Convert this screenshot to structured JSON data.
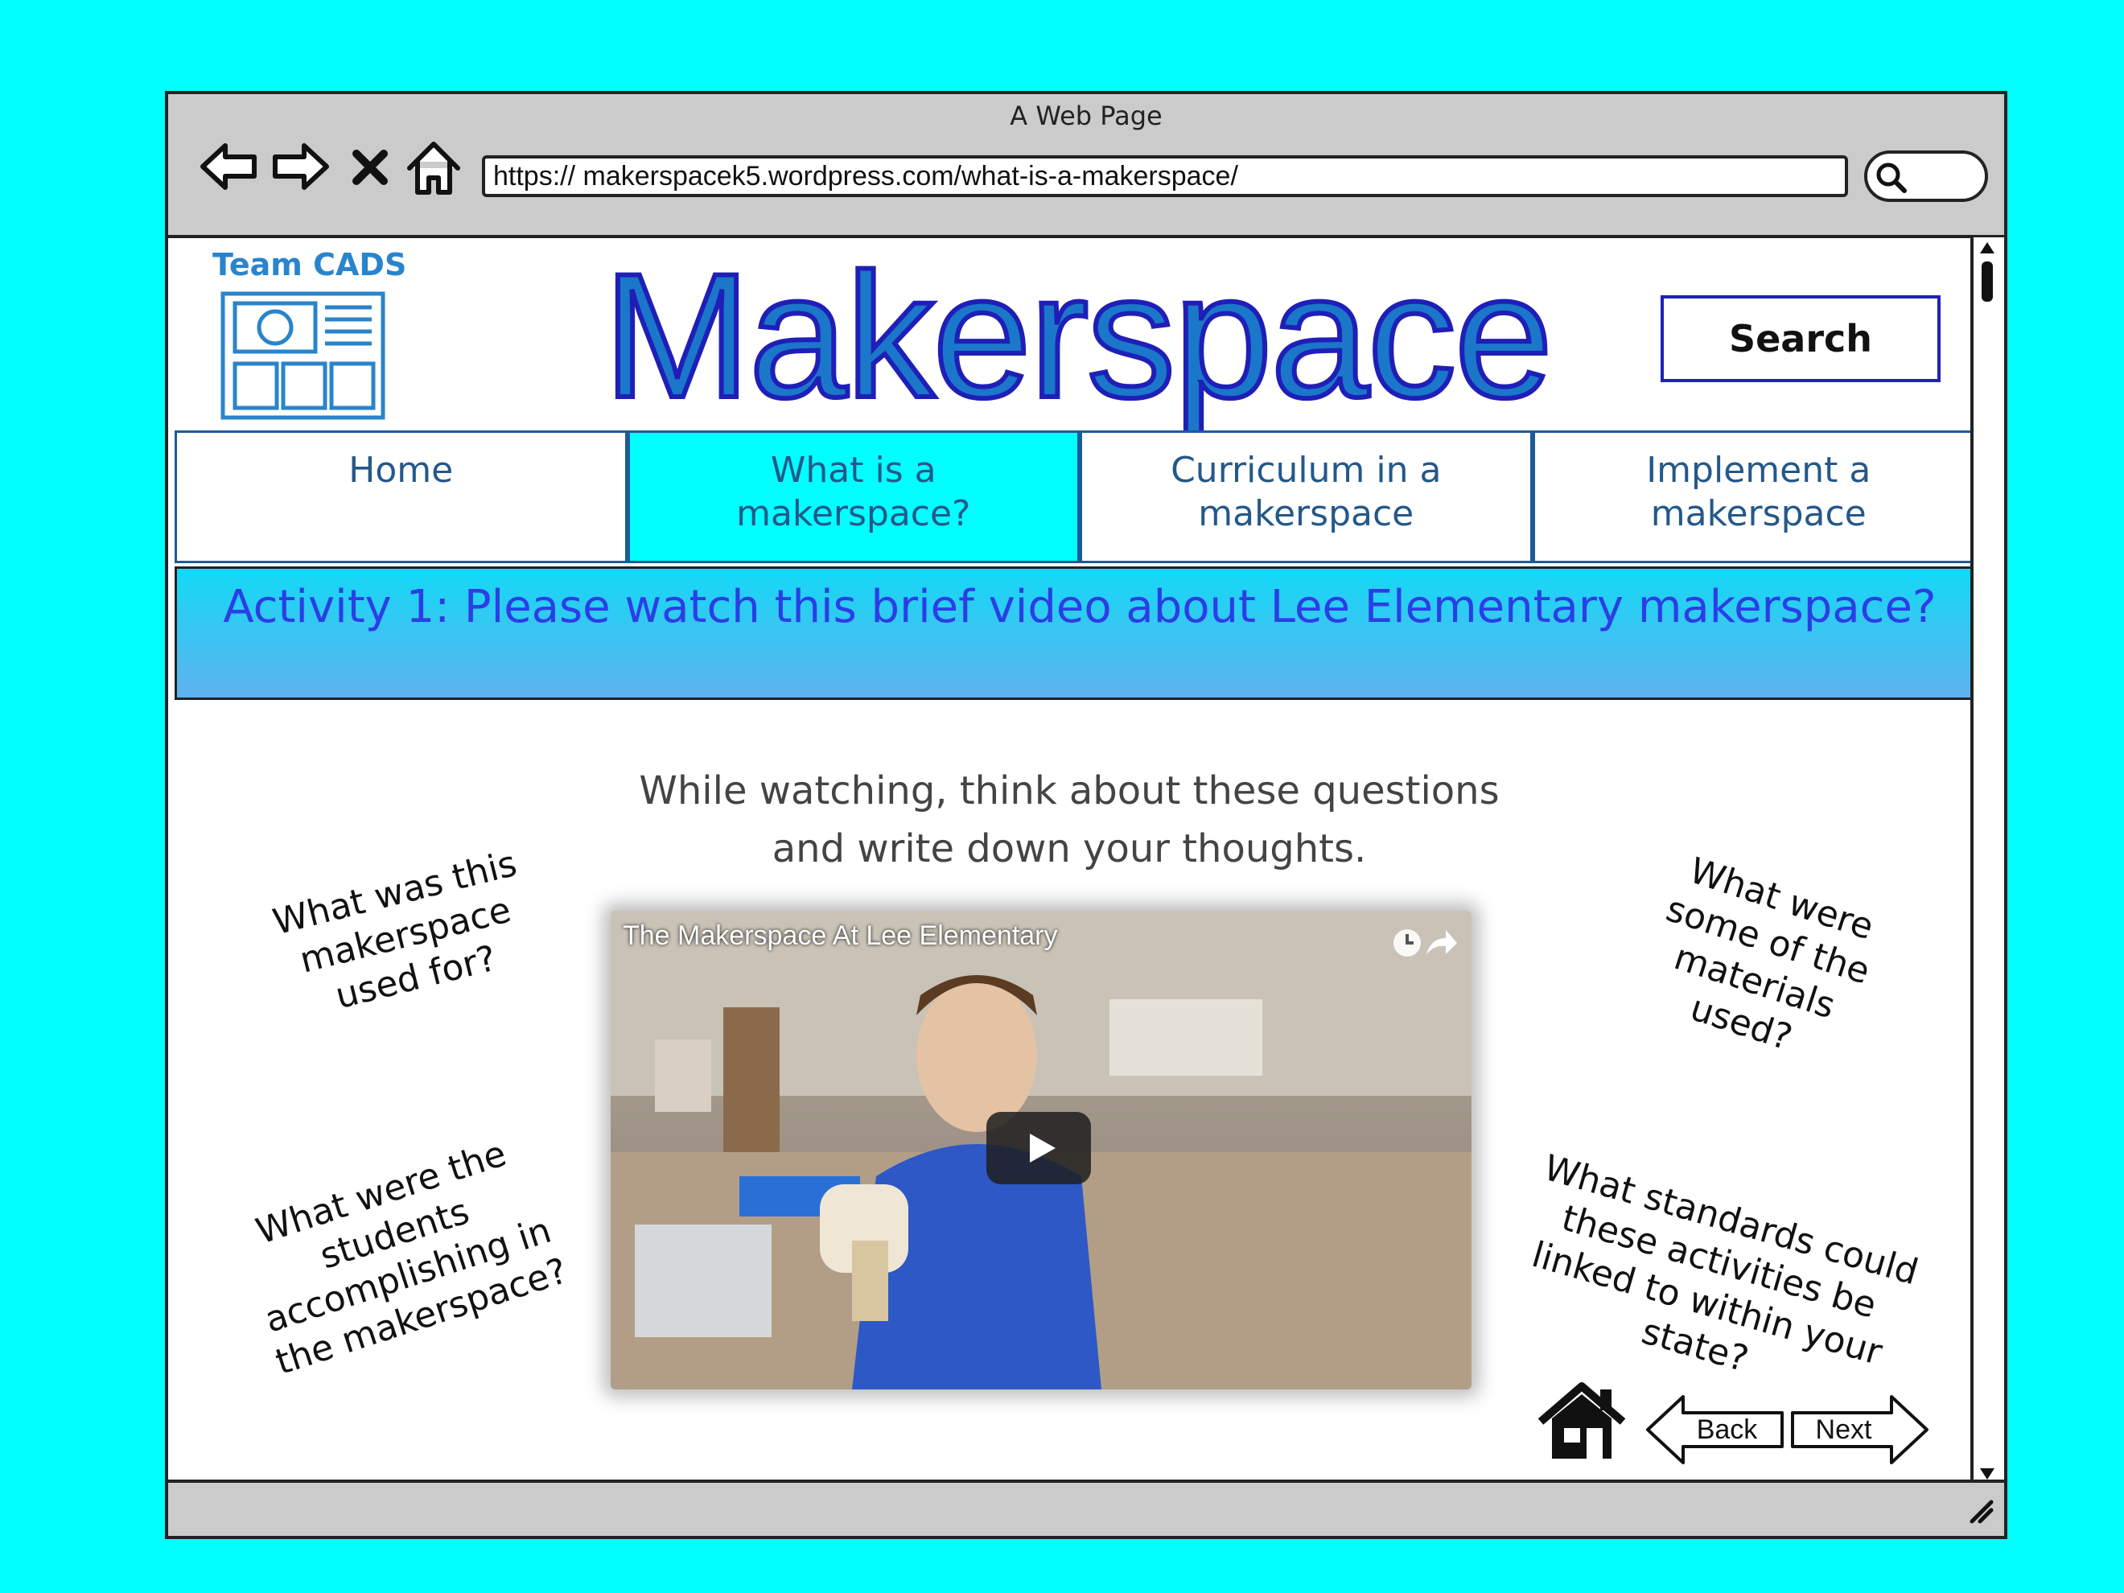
{
  "window": {
    "title": "A Web Page",
    "url": "https:// makerspacek5.wordpress.com/what-is-a-makerspace/"
  },
  "header": {
    "logo_text": "Team CADS",
    "site_title": "Makerspace",
    "search_label": "Search"
  },
  "tabs": [
    {
      "label": "Home",
      "active": false
    },
    {
      "label": "What is a makerspace?",
      "active": true
    },
    {
      "label": "Curriculum in a makerspace",
      "active": false
    },
    {
      "label": "Implement a makerspace",
      "active": false
    }
  ],
  "banner": {
    "text": "Activity 1: Please watch this brief video about Lee Elementary makerspace?"
  },
  "intro": {
    "line1": "While watching, think about these questions",
    "line2": "and write down your thoughts."
  },
  "questions": {
    "q1": "What was this\nmakerspace\nused for?",
    "q2": "What were the\nstudents\naccomplishing in\nthe makerspace?",
    "q3": "What were\nsome of the\nmaterials\nused?",
    "q4": "What standards could\nthese activities be\nlinked to within your\nstate?"
  },
  "video": {
    "title": "The Makerspace At Lee Elementary"
  },
  "footer_nav": {
    "back_label": "Back",
    "next_label": "Next"
  },
  "colors": {
    "page_background": "#00ffff",
    "active_tab": "#00ffff",
    "banner_text": "#2b3ee6",
    "site_title": "#1a77c9"
  }
}
